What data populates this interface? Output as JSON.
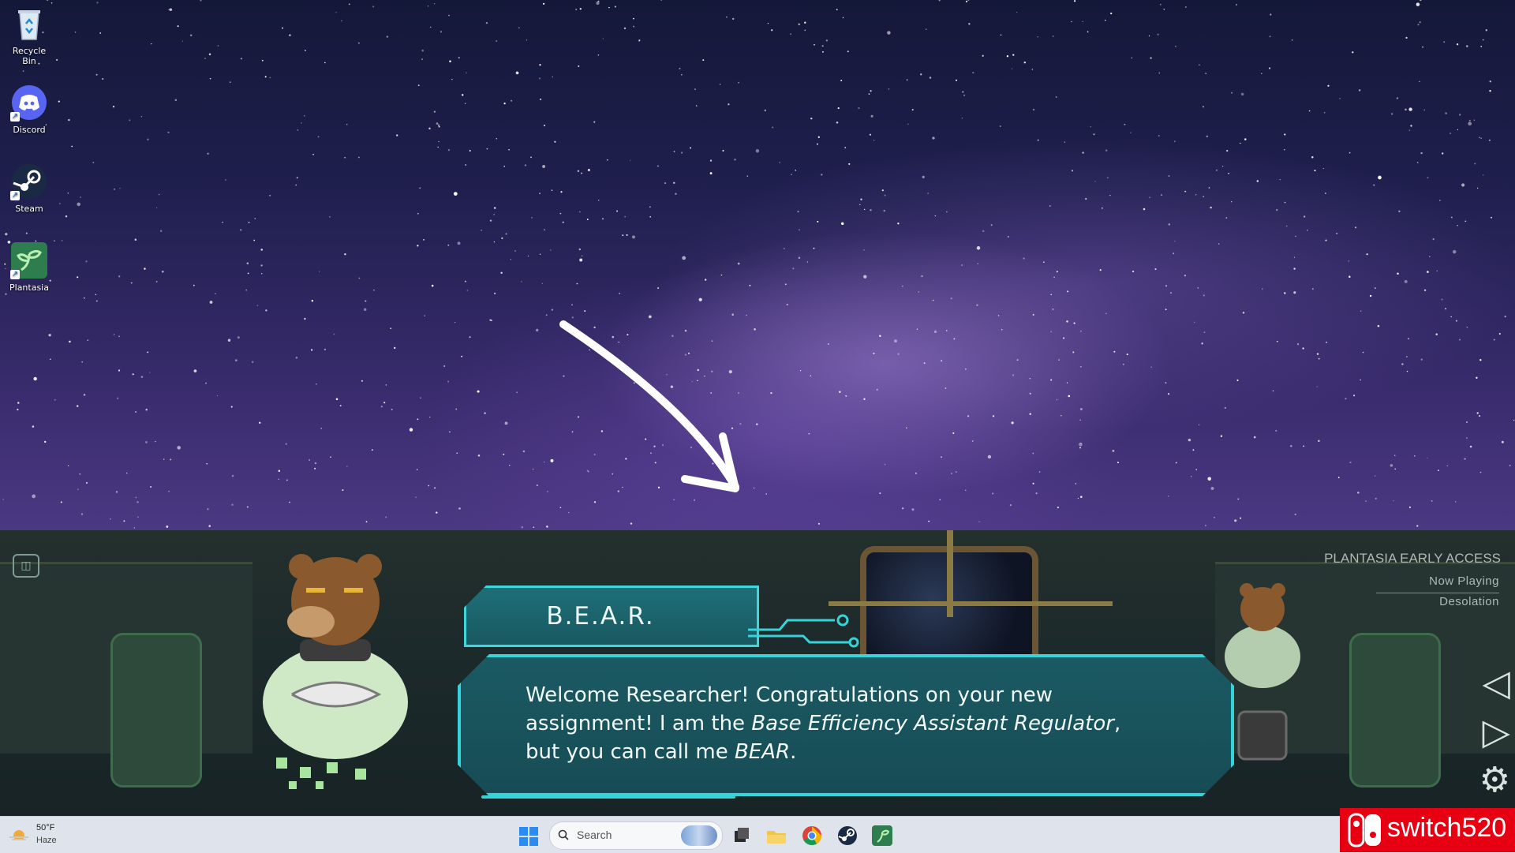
{
  "desktop": {
    "icons": [
      {
        "label": "Recycle Bin",
        "icon": "recycle-bin-icon"
      },
      {
        "label": "Discord",
        "icon": "discord-icon"
      },
      {
        "label": "Steam",
        "icon": "steam-icon"
      },
      {
        "label": "Plantasia",
        "icon": "plantasia-icon"
      }
    ]
  },
  "game": {
    "camera_icon": "camera-icon",
    "speaker_name": "B.E.A.R.",
    "dialog": {
      "part1": "Welcome Researcher! Congratulations on your new assignment! I am the ",
      "italic1": "Base Efficiency Assistant Regulator",
      "part2": ", but you can call me ",
      "italic2": "BEAR",
      "part3": "."
    },
    "music": {
      "title": "PLANTASIA EARLY ACCESS",
      "now_playing": "Now Playing",
      "track": "Desolation"
    },
    "controls": {
      "prev_icon": "◁",
      "next_icon": "▷",
      "settings_icon": "⚙"
    }
  },
  "taskbar": {
    "weather": {
      "temp": "50°F",
      "condition": "Haze"
    },
    "search_placeholder": "Search",
    "apps": [
      "start-icon",
      "task-view-icon",
      "file-explorer-icon",
      "chrome-icon",
      "steam-icon",
      "plantasia-icon"
    ]
  },
  "watermark": {
    "text": "switch520"
  },
  "colors": {
    "dialog_border": "#36d3da",
    "dialog_bg": "#1b5a63",
    "watermark_red": "#e60012"
  }
}
